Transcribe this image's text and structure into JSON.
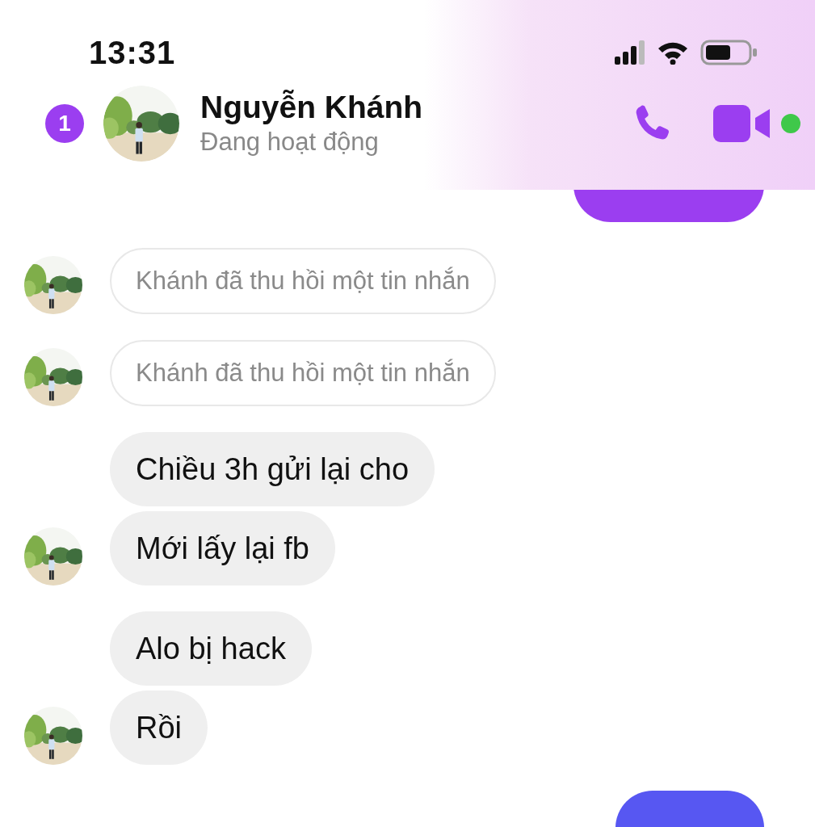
{
  "status_bar": {
    "time": "13:31"
  },
  "header": {
    "unread_count": "1",
    "contact_name": "Nguyễn Khánh",
    "presence": "Đang hoạt động",
    "online": true
  },
  "messages": [
    {
      "kind": "sent_cut_top"
    },
    {
      "kind": "recalled",
      "text": "Khánh đã thu hồi một tin nhắn",
      "show_avatar": true
    },
    {
      "kind": "recalled",
      "text": "Khánh đã thu hồi một tin nhắn",
      "show_avatar": true
    },
    {
      "kind": "received",
      "text": "Chiều 3h gửi lại cho",
      "show_avatar": false
    },
    {
      "kind": "received",
      "text": "Mới lấy lại fb",
      "show_avatar": true
    },
    {
      "kind": "received",
      "text": "Alo bị hack",
      "show_avatar": false
    },
    {
      "kind": "received",
      "text": "Rồi",
      "show_avatar": true
    },
    {
      "kind": "sent_cut_bottom"
    }
  ]
}
